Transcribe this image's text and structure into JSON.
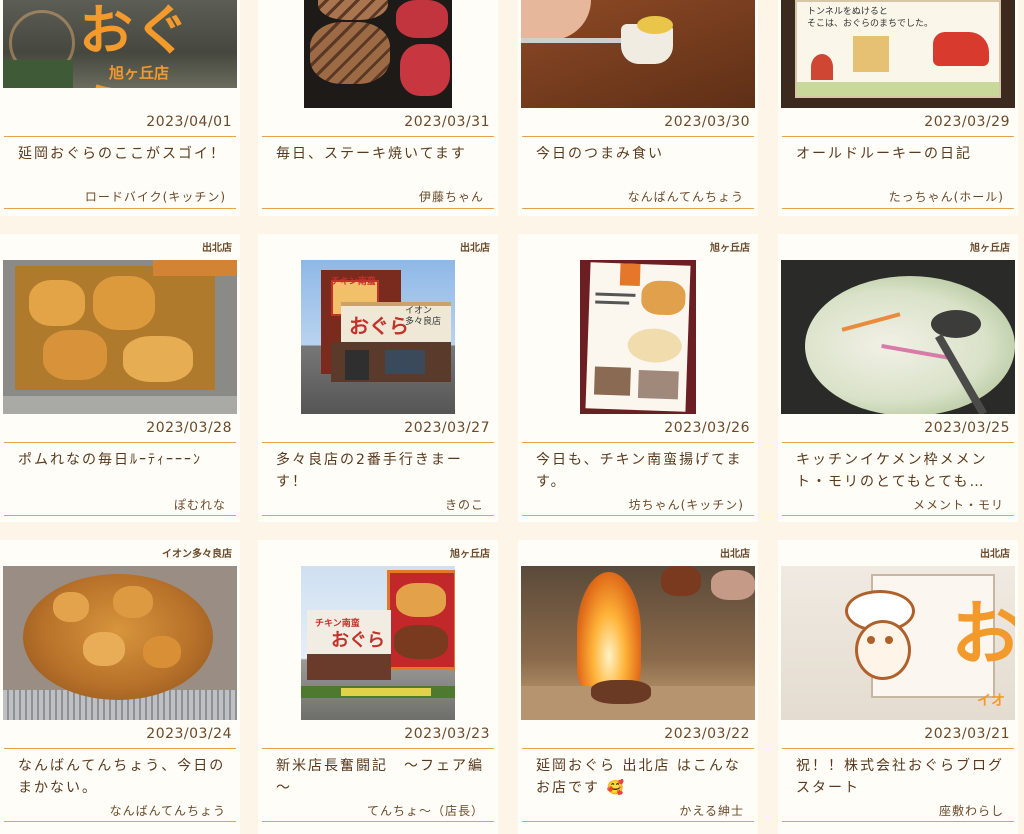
{
  "posts": [
    {
      "date": "2023/04/01",
      "title": "延岡おぐらのここがスゴイ！",
      "author": "ロードバイク(キッチン)",
      "store": "",
      "sign_big": "おぐら",
      "sign_small": "旭ヶ丘店"
    },
    {
      "date": "2023/03/31",
      "title": "毎日、ステーキ焼いてます",
      "author": "伊藤ちゃん",
      "store": ""
    },
    {
      "date": "2023/03/30",
      "title": "今日のつまみ食い",
      "author": "なんばんてんちょう",
      "store": ""
    },
    {
      "date": "2023/03/29",
      "title": "オールドルーキーの日記",
      "author": "たっちゃん(ホール)",
      "store": "",
      "sign_line1": "トンネルをぬけると",
      "sign_line2": "そこは、おぐらのまちでした。"
    },
    {
      "date": "2023/03/28",
      "title": "ポムれなの毎日ﾙｰﾃｨｰｰｰﾝ",
      "author": "ぽむれな",
      "store": "出北店"
    },
    {
      "date": "2023/03/27",
      "title": "多々良店の2番手行きまーす！",
      "author": "きのこ",
      "store": "出北店",
      "sign_big": "おぐら",
      "sign_small": "イオン多々良店",
      "sign_top": "チキン南蛮"
    },
    {
      "date": "2023/03/26",
      "title": "今日も、チキン南蛮揚げてます。",
      "author": "坊ちゃん(キッチン)",
      "store": "旭ヶ丘店"
    },
    {
      "date": "2023/03/25",
      "title": "キッチンイケメン枠メメント・モリのとてもとても…",
      "author": "メメント・モリ",
      "store": "旭ヶ丘店"
    },
    {
      "date": "2023/03/24",
      "title": "なんばんてんちょう、今日のまかない。",
      "author": "なんばんてんちょう",
      "store": "イオン多々良店"
    },
    {
      "date": "2023/03/23",
      "title": "新米店長奮闘記　～フェア編～",
      "author": "てんちょ～（店長）",
      "store": "旭ヶ丘店",
      "sign_big": "おぐら",
      "sign_top": "チキン南蛮"
    },
    {
      "date": "2023/03/22",
      "title": "延岡おぐら 出北店 はこんなお店です 🥰",
      "author": "かえる紳士",
      "store": "出北店"
    },
    {
      "date": "2023/03/21",
      "title": "祝！！株式会社おぐらブログスタート",
      "author": "座敷わらし",
      "store": "出北店",
      "sign_big": "お",
      "sign_small": "イオ"
    }
  ]
}
